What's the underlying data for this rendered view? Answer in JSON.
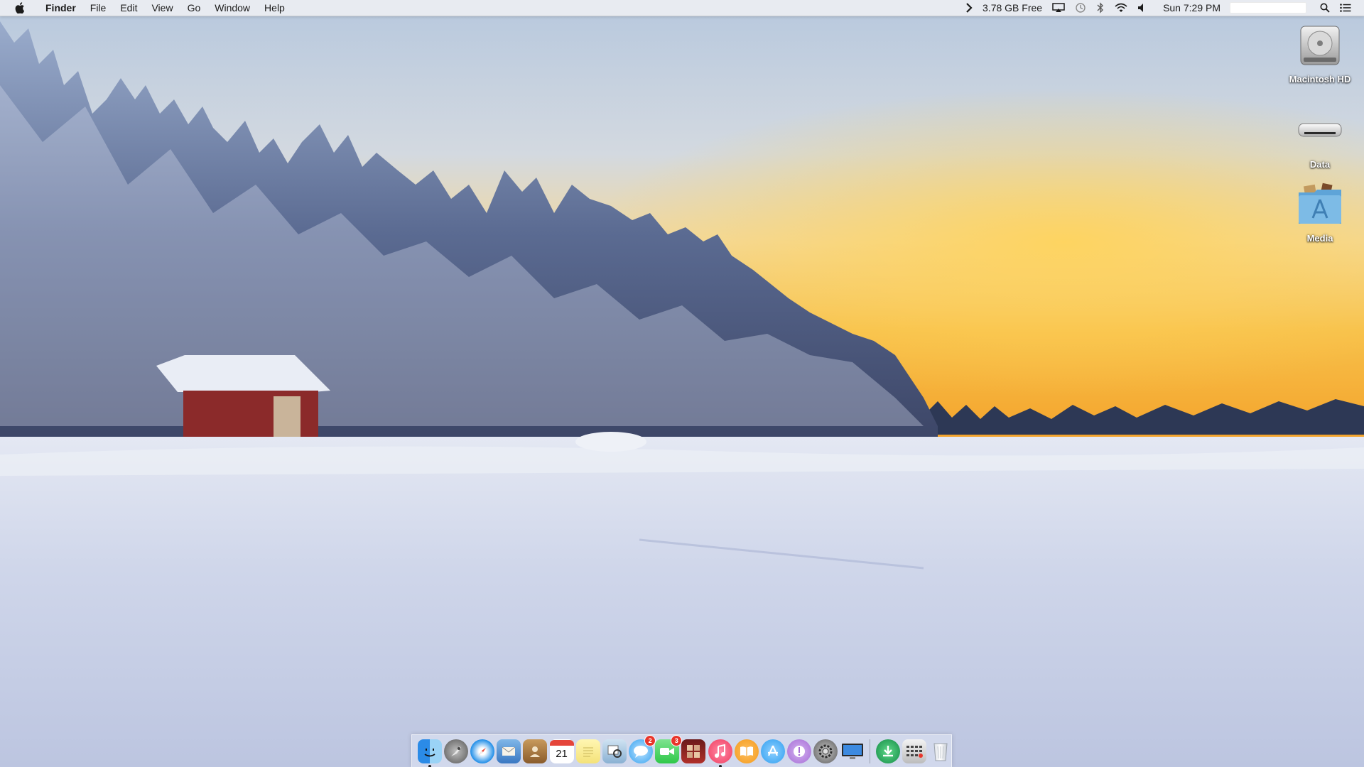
{
  "menubar": {
    "app_name": "Finder",
    "menus": [
      {
        "label": "File"
      },
      {
        "label": "Edit"
      },
      {
        "label": "View"
      },
      {
        "label": "Go"
      },
      {
        "label": "Window"
      },
      {
        "label": "Help"
      }
    ],
    "status": {
      "memory_free": "3.78 GB Free",
      "clock": "Sun 7:29 PM"
    },
    "icons": [
      "apple-icon",
      "chevron-right-icon",
      "airplay-icon",
      "time-machine-icon",
      "bluetooth-icon",
      "wifi-icon",
      "volume-icon",
      "spotlight-search-icon",
      "notification-center-icon"
    ]
  },
  "desktop": {
    "icons": [
      {
        "label": "Macintosh HD",
        "icon": "hard-drive-icon"
      },
      {
        "label": "Data",
        "icon": "mac-mini-icon"
      },
      {
        "label": "Media",
        "icon": "applications-folder-icon"
      }
    ]
  },
  "dock": {
    "apps": [
      {
        "icon": "finder-icon",
        "running": true
      },
      {
        "icon": "launchpad-icon"
      },
      {
        "icon": "safari-icon"
      },
      {
        "icon": "mail-icon"
      },
      {
        "icon": "contacts-icon"
      },
      {
        "icon": "calendar-icon",
        "calendar_day": "21"
      },
      {
        "icon": "notes-icon"
      },
      {
        "icon": "preview-icon"
      },
      {
        "icon": "messages-icon",
        "badge": "2"
      },
      {
        "icon": "facetime-icon",
        "badge": "3"
      },
      {
        "icon": "photo-booth-icon"
      },
      {
        "icon": "itunes-icon",
        "running": true
      },
      {
        "icon": "ibooks-icon"
      },
      {
        "icon": "app-store-icon"
      },
      {
        "icon": "feedback-icon"
      },
      {
        "icon": "system-preferences-icon"
      },
      {
        "icon": "display-icon"
      },
      {
        "icon": "download-manager-icon"
      },
      {
        "icon": "grid-app-icon"
      },
      {
        "icon": "trash-icon"
      }
    ],
    "colors": {
      "itunes": "#f03c5f",
      "safari": "#1e8de8",
      "app_store": "#2f9ff0",
      "ibooks": "#f39a1b",
      "feedback": "#a66cd6",
      "messages": "#35a3f0",
      "facetime": "#2fc84a"
    }
  }
}
